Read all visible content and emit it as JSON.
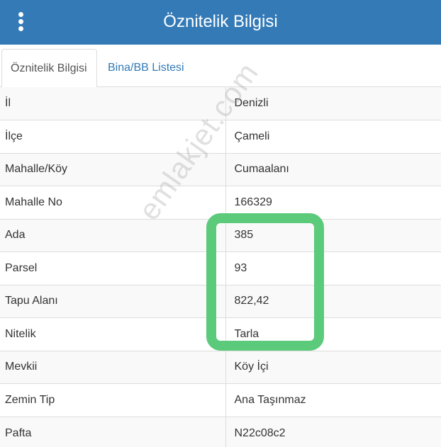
{
  "header": {
    "title": "Öznitelik Bilgisi",
    "menu_icon": "vertical-ellipsis-icon"
  },
  "tabs": [
    {
      "label": "Öznitelik Bilgisi",
      "active": true
    },
    {
      "label": "Bina/BB Listesi",
      "active": false
    }
  ],
  "attributes": [
    {
      "key": "İl",
      "value": "Denizli"
    },
    {
      "key": "İlçe",
      "value": "Çameli"
    },
    {
      "key": "Mahalle/Köy",
      "value": "Cumaalanı"
    },
    {
      "key": "Mahalle No",
      "value": "166329"
    },
    {
      "key": "Ada",
      "value": "385"
    },
    {
      "key": "Parsel",
      "value": "93"
    },
    {
      "key": "Tapu Alanı",
      "value": "822,42"
    },
    {
      "key": "Nitelik",
      "value": "Tarla"
    },
    {
      "key": "Mevkii",
      "value": "Köy İçi"
    },
    {
      "key": "Zemin Tip",
      "value": "Ana Taşınmaz"
    },
    {
      "key": "Pafta",
      "value": "N22c08c2"
    }
  ],
  "watermark": "emlakjet.com",
  "colors": {
    "header_bg": "#337ab7",
    "link": "#337ab7",
    "highlight": "#5bca7a",
    "row_stripe": "#f9f9f9"
  }
}
